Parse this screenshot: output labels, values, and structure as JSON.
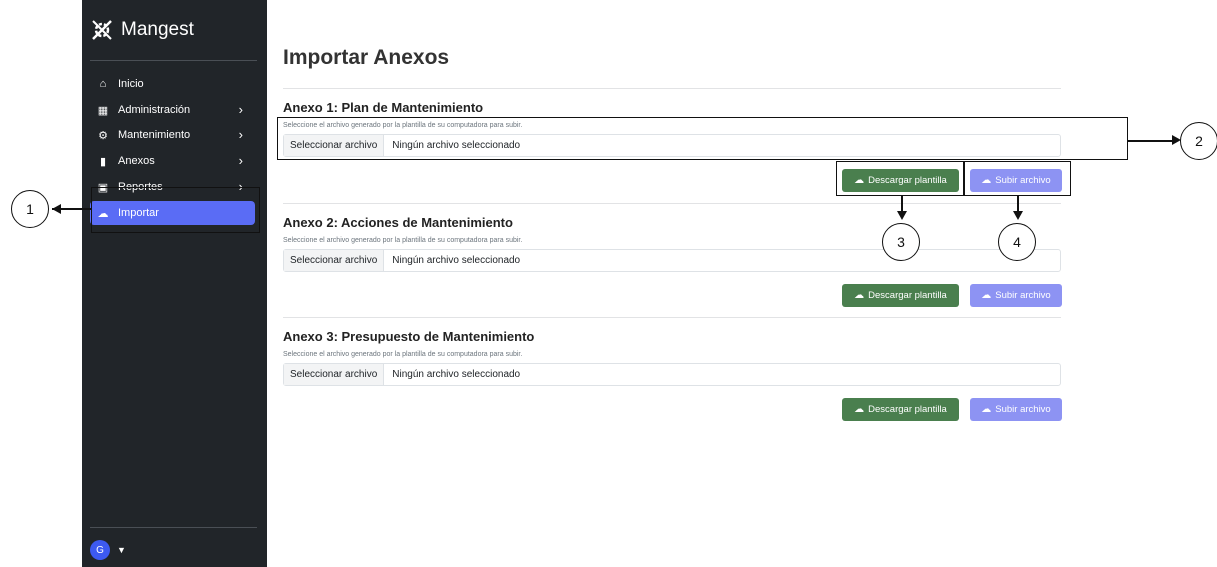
{
  "sidebar": {
    "brand": "Mangest",
    "items": [
      {
        "label": "Inicio",
        "icon": "home-icon"
      },
      {
        "label": "Administración",
        "icon": "building-icon"
      },
      {
        "label": "Mantenimiento",
        "icon": "gear-icon"
      },
      {
        "label": "Anexos",
        "icon": "clipboard-icon"
      },
      {
        "label": "Reportes",
        "icon": "briefcase-icon"
      },
      {
        "label": "Importar",
        "icon": "cloud-upload-icon"
      }
    ],
    "user_initial": "G"
  },
  "main": {
    "title": "Importar Anexos",
    "annexes": [
      {
        "title": "Anexo 1: Plan de Mantenimiento",
        "hint": "Seleccione el archivo generado por la plantilla de su computadora para subir.",
        "file_button": "Seleccionar archivo",
        "file_name": "Ningún archivo seleccionado",
        "download": "Descargar plantilla",
        "upload": "Subir archivo"
      },
      {
        "title": "Anexo 2: Acciones de Mantenimiento",
        "hint": "Seleccione el archivo generado por la plantilla de su computadora para subir.",
        "file_button": "Seleccionar archivo",
        "file_name": "Ningún archivo seleccionado",
        "download": "Descargar plantilla",
        "upload": "Subir archivo"
      },
      {
        "title": "Anexo 3: Presupuesto de Mantenimiento",
        "hint": "Seleccione el archivo generado por la plantilla de su computadora para subir.",
        "file_button": "Seleccionar archivo",
        "file_name": "Ningún archivo seleccionado",
        "download": "Descargar plantilla",
        "upload": "Subir archivo"
      }
    ]
  },
  "callouts": [
    "1",
    "2",
    "3",
    "4"
  ],
  "colors": {
    "sidebar_bg": "#212529",
    "active_item": "#5a6cf5",
    "download_btn": "#4a7f4e",
    "upload_btn": "#8d93f3"
  }
}
